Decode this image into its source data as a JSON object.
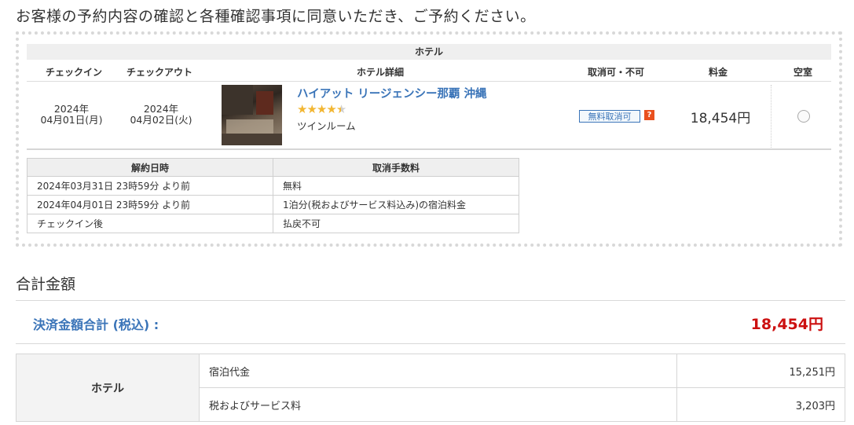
{
  "page": {
    "heading": "お客様の予約内容の確認と各種確認事項に同意いただき、ご予約ください。"
  },
  "hotel_section": {
    "header": "ホテル",
    "columns": {
      "checkin": "チェックイン",
      "checkout": "チェックアウト",
      "details": "ホテル詳細",
      "cancel": "取消可・不可",
      "price": "料金",
      "availability": "空室"
    },
    "booking": {
      "checkin_year": "2024年",
      "checkin_day": "04月01日(月)",
      "checkout_year": "2024年",
      "checkout_day": "04月02日(火)",
      "hotel_name": "ハイアット リージェンシー那覇 沖縄",
      "rating": 4.5,
      "room_type": "ツインルーム",
      "cancel_badge": "無料取消可",
      "help_icon": "?",
      "price": "18,454円",
      "selected": false
    },
    "policy": {
      "head_date": "解約日時",
      "head_fee": "取消手数料",
      "rows": [
        {
          "date": "2024年03月31日 23時59分 より前",
          "fee": "無料"
        },
        {
          "date": "2024年04月01日 23時59分 より前",
          "fee": "1泊分(税およびサービス料込み)の宿泊料金"
        },
        {
          "date": "チェックイン後",
          "fee": "払戻不可"
        }
      ]
    }
  },
  "totals": {
    "title": "合計金額",
    "label": "決済金額合計 (税込) :",
    "amount": "18,454円",
    "breakdown": {
      "category": "ホテル",
      "items": [
        {
          "name": "宿泊代金",
          "value": "15,251円"
        },
        {
          "name": "税およびサービス料",
          "value": "3,203円"
        }
      ]
    }
  },
  "colors": {
    "link_blue": "#3a74b8",
    "total_red": "#cc1010",
    "help_orange": "#e9501e",
    "star": "#f2b632"
  },
  "icons": {
    "star": "star-icon",
    "help": "help-icon",
    "radio": "radio-button"
  }
}
